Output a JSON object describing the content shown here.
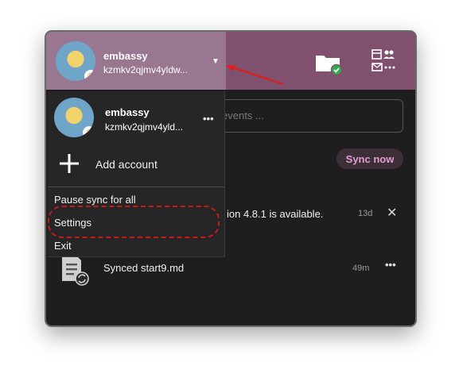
{
  "header": {
    "account_name": "embassy",
    "account_id": "kzmkv2qjmv4yldw...",
    "folder_icon": "folder-check-icon",
    "calendar_icon": "calendar-people-icon"
  },
  "search": {
    "placeholder_visible": "events ..."
  },
  "sync_now_label": "Sync now",
  "notifications": [
    {
      "text": "ion 4.8.1 is available.",
      "time": "13d"
    },
    {
      "text": "Synced start9.md",
      "time": "49m"
    }
  ],
  "dropdown": {
    "account_name": "embassy",
    "account_id": "kzmkv2qjmv4yld...",
    "more_label": "•••",
    "add_account_label": "Add account",
    "pause_label": "Pause sync for all",
    "settings_label": "Settings",
    "exit_label": "Exit"
  },
  "colors": {
    "header": "#80506f",
    "account_button": "#9a7790",
    "accent_pink": "#e59bd4",
    "annotation_red": "#c91a1a"
  }
}
